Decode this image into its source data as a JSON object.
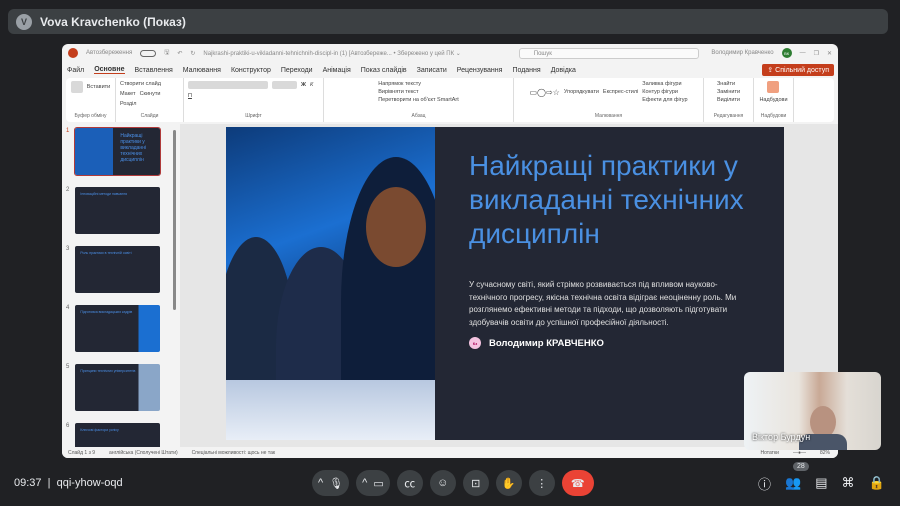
{
  "meet": {
    "presenter": "Vova Kravchenko (Показ)",
    "presenter_initial": "V",
    "time": "09:37",
    "meeting_code": "qqi-yhow-oqd",
    "participants_count": "28",
    "video_participant": "Віктор Бурдун"
  },
  "ppt": {
    "autosave": "Автозбереження",
    "filename": "Najkrashi-praktiki-u-vikladanni-tehnichnih-discipl-in (1) [Автозбереже... • Збережено у цей ПК ⌄",
    "search_placeholder": "Пошук",
    "user": "Володимир Кравченко",
    "user_initials": "ВК",
    "share": "Спільний доступ",
    "menu": [
      "Файл",
      "Основне",
      "Вставлення",
      "Малювання",
      "Конструктор",
      "Переходи",
      "Анімація",
      "Показ слайдів",
      "Записати",
      "Рецензування",
      "Подання",
      "Довідка"
    ],
    "ribbon": {
      "paste": "Вставити",
      "clipboard": "Буфер обміну",
      "new_slide": "Створити слайд",
      "layout": "Макет",
      "reset": "Скинути",
      "section": "Розділ",
      "slides": "Слайди",
      "font": "Шрифт",
      "text_dir": "Напрямок тексту",
      "align_text": "Вирівняти текст",
      "smartart": "Перетворити на об'єкт SmartArt",
      "paragraph": "Абзац",
      "arrange": "Упорядкувати",
      "quick_styles": "Експрес-стилі",
      "fill": "Заливка фігури",
      "outline": "Контур фігури",
      "effects": "Ефекти для фігур",
      "drawing": "Малювання",
      "find": "Знайти",
      "replace": "Замінити",
      "select": "Виділити",
      "editing": "Редагування",
      "addins": "Надбудови",
      "addins_group": "Надбудови"
    },
    "thumbnails": [
      {
        "n": "1",
        "t": "Найкращі практики у викладанні технічних дисциплін"
      },
      {
        "n": "2",
        "t": "Інноваційні методи навчання"
      },
      {
        "n": "3",
        "t": "Роль практики в технічній освіті"
      },
      {
        "n": "4",
        "t": "Підготовка викладацьких кадрів"
      },
      {
        "n": "5",
        "t": "Принципи технічних університетів"
      },
      {
        "n": "6",
        "t": "Ключові фактори успіху"
      }
    ],
    "slide": {
      "title": "Найкращі практики у викладанні технічних дисциплін",
      "description": "У сучасному світі, який стрімко розвивається під впливом науково-технічного прогресу, якісна технічна освіта відіграє неоціненну роль. Ми розглянемо ефективні методи та підходи, що дозволяють підготувати здобувачів освіти до успішної професійної діяльності.",
      "author": "Володимир КРАВЧЕНКО",
      "author_initials": "Кз"
    },
    "status": {
      "slide": "Слайд 1 з 9",
      "language": "англійська (Сполучені Штати)",
      "accessibility": "Спеціальні можливості: щось не так",
      "notes": "Нотатки",
      "zoom": "82%"
    }
  }
}
